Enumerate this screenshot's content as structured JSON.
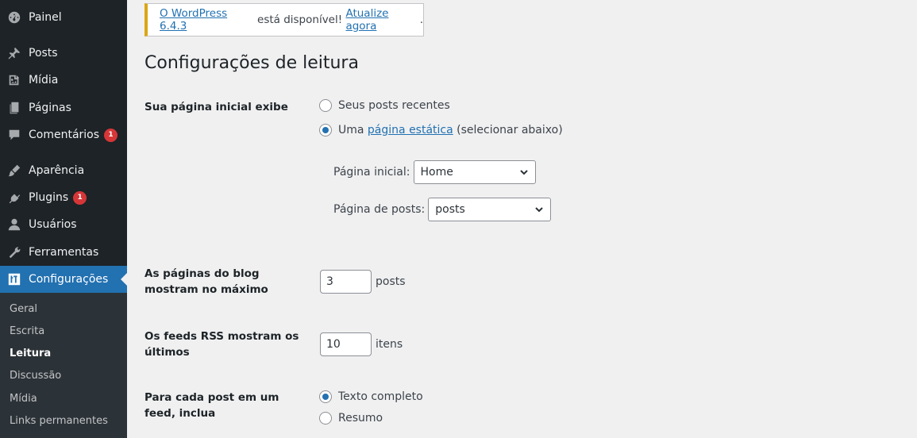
{
  "sidebar": {
    "items": [
      {
        "label": "Painel",
        "icon": "dashboard-icon"
      },
      {
        "label": "Posts",
        "icon": "pin-icon"
      },
      {
        "label": "Mídia",
        "icon": "media-icon"
      },
      {
        "label": "Páginas",
        "icon": "page-icon"
      },
      {
        "label": "Comentários",
        "icon": "comment-icon",
        "badge": "1"
      },
      {
        "label": "Aparência",
        "icon": "brush-icon"
      },
      {
        "label": "Plugins",
        "icon": "plugin-icon",
        "badge": "1"
      },
      {
        "label": "Usuários",
        "icon": "user-icon"
      },
      {
        "label": "Ferramentas",
        "icon": "wrench-icon"
      },
      {
        "label": "Configurações",
        "icon": "settings-icon"
      }
    ],
    "submenu": [
      "Geral",
      "Escrita",
      "Leitura",
      "Discussão",
      "Mídia",
      "Links permanentes"
    ]
  },
  "notice": {
    "link1": "O WordPress 6.4.3",
    "middle": " está disponível! ",
    "link2": "Atualize agora",
    "end": "."
  },
  "page": {
    "title": "Configurações de leitura"
  },
  "homepage": {
    "label": "Sua página inicial exibe",
    "option_posts": "Seus posts recentes",
    "option_static_prefix": "Uma ",
    "option_static_link": "página estática",
    "option_static_suffix": " (selecionar abaixo)",
    "home_label": "Página inicial:",
    "home_value": "Home",
    "posts_label": "Página de posts:",
    "posts_value": "posts"
  },
  "blog_pages": {
    "label": "As páginas do blog mostram no máximo",
    "value": "3",
    "unit": "posts"
  },
  "feeds": {
    "label": "Os feeds RSS mostram os últimos",
    "value": "10",
    "unit": "itens"
  },
  "feed_content": {
    "label": "Para cada post em um feed, inclua",
    "option_full": "Texto completo",
    "option_summary": "Resumo"
  },
  "colors": {
    "sidebar_bg": "#1d2327",
    "accent": "#2271b1",
    "badge": "#d63638",
    "notice_border": "#dba617"
  }
}
